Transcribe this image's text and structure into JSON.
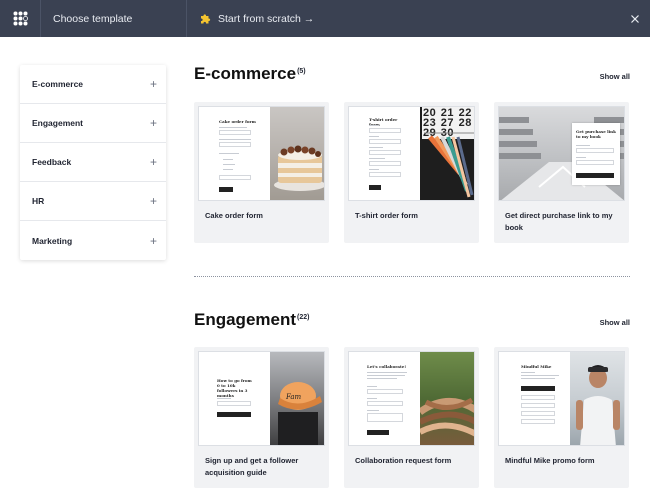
{
  "topbar": {
    "title": "Choose template",
    "scratch_label": "Start from scratch →"
  },
  "sidebar": {
    "items": [
      {
        "label": "E-commerce"
      },
      {
        "label": "Engagement"
      },
      {
        "label": "Feedback"
      },
      {
        "label": "HR"
      },
      {
        "label": "Marketing"
      }
    ]
  },
  "sections": [
    {
      "title": "E-commerce",
      "count": "(5)",
      "show_all": "Show all",
      "cards": [
        {
          "title": "Cake order form",
          "thumb_title": "Cake order form"
        },
        {
          "title": "T-shirt order form",
          "thumb_title": "T-shirt order form",
          "thumb_numbers": "20 21 22 23 27 28 29 30"
        },
        {
          "title": "Get direct purchase link to my book",
          "thumb_title": "Get purchase link to my book"
        }
      ]
    },
    {
      "title": "Engagement",
      "count": "(22)",
      "show_all": "Show all",
      "cards": [
        {
          "title": "Sign up and get a follower acquisition guide",
          "thumb_title": "How to go from 0 to 10k followers in 3 months"
        },
        {
          "title": "Collaboration request form",
          "thumb_title": "Let's collaborate!"
        },
        {
          "title": "Mindful Mike promo form",
          "thumb_title": "Mindful Mike"
        }
      ]
    }
  ],
  "colors": {
    "topbar_bg": "#3a4152",
    "card_bg": "#f1f2f4",
    "accent_icon": "#f4c430"
  }
}
